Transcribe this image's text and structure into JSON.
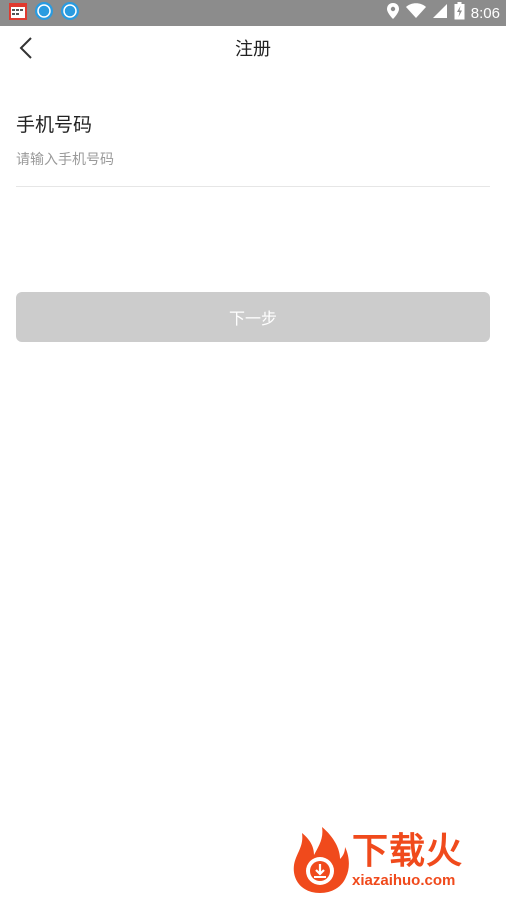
{
  "statusbar": {
    "time": "8:06",
    "icons": [
      "app-icon-calendar",
      "app-icon-fox-1",
      "app-icon-fox-2",
      "location-icon",
      "wifi-icon",
      "signal-icon",
      "battery-charging-icon"
    ]
  },
  "header": {
    "title": "注册",
    "back_icon": "chevron-left-icon"
  },
  "form": {
    "phone_label": "手机号码",
    "phone_value": "",
    "phone_placeholder": "请输入手机号码"
  },
  "actions": {
    "next_label": "下一步"
  },
  "watermark": {
    "cn": "下载火",
    "en": "xiazaihuo.com"
  },
  "colors": {
    "statusbar": "#8c8c8c",
    "button_disabled": "#cccccc",
    "brand_orange": "#f04a1c"
  }
}
